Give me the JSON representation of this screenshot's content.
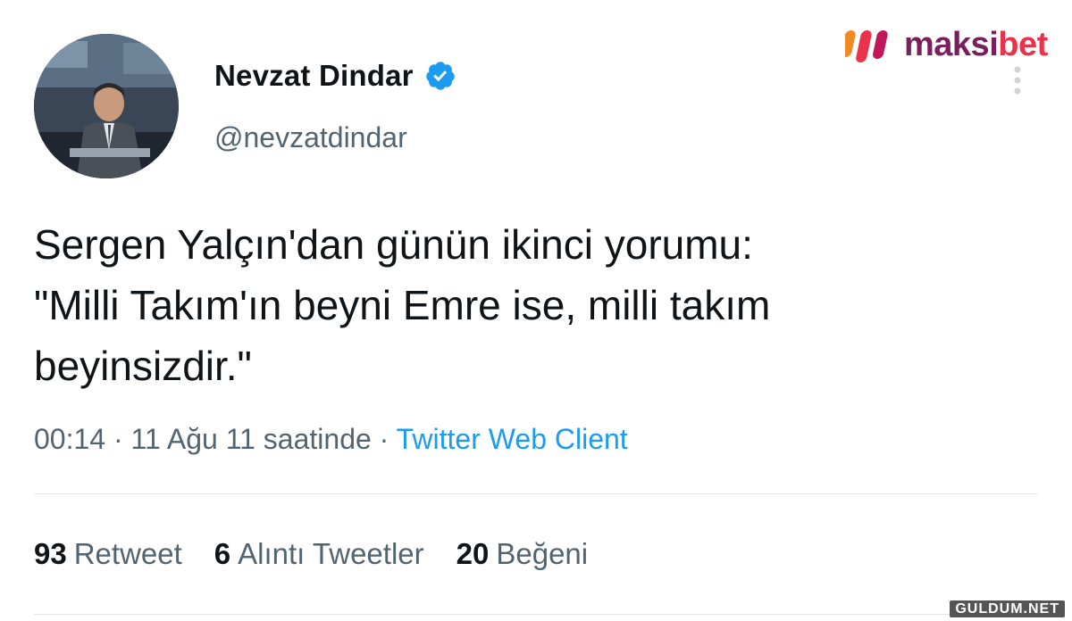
{
  "author": {
    "name": "Nevzat Dindar",
    "handle": "@nevzatdindar",
    "verified": true
  },
  "brand": {
    "text_primary": "maksi",
    "text_accent": "bet",
    "color_primary": "#7a1f5e",
    "color_accent": "#e8334a"
  },
  "tweet": {
    "lines": [
      "Sergen Yalçın'dan günün ikinci yorumu:",
      "\"Milli Takım'ın beyni Emre ise, milli takım",
      "beyinsizdir.\""
    ],
    "time": "00:14",
    "sep1": "·",
    "date": "11 Ağu 11 saatinde",
    "sep2": "·",
    "client": "Twitter Web Client"
  },
  "stats": {
    "retweets_count": "93",
    "retweets_label": "Retweet",
    "quotes_count": "6",
    "quotes_label": "Alıntı Tweetler",
    "likes_count": "20",
    "likes_label": "Beğeni"
  },
  "watermark": "GULDUM.NET",
  "colors": {
    "accent": "#1d9bf0",
    "secondary_text": "#536471",
    "primary_text": "#0f1419"
  }
}
